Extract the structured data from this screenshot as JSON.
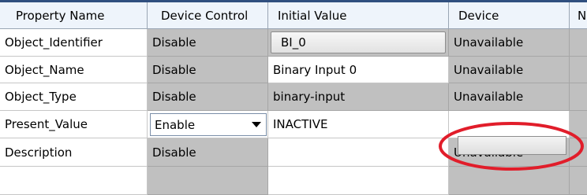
{
  "headers": [
    "Property Name",
    "Device Control",
    "Initial Value",
    "Device",
    "N"
  ],
  "rows": [
    {
      "name": "Object_Identifier",
      "control": "Disable",
      "initial": "BI_0",
      "device": "Unavailable"
    },
    {
      "name": "Object_Name",
      "control": "Disable",
      "initial": "Binary Input 0",
      "device": "Unavailable"
    },
    {
      "name": "Object_Type",
      "control": "Disable",
      "initial": "binary-input",
      "device": "Unavailable"
    },
    {
      "name": "Present_Value",
      "control": "Enable",
      "initial": "INACTIVE",
      "device": ""
    },
    {
      "name": "Description",
      "control": "Disable",
      "initial": "",
      "device": "Unavailable"
    }
  ],
  "highlight_color": "#e11d2a"
}
